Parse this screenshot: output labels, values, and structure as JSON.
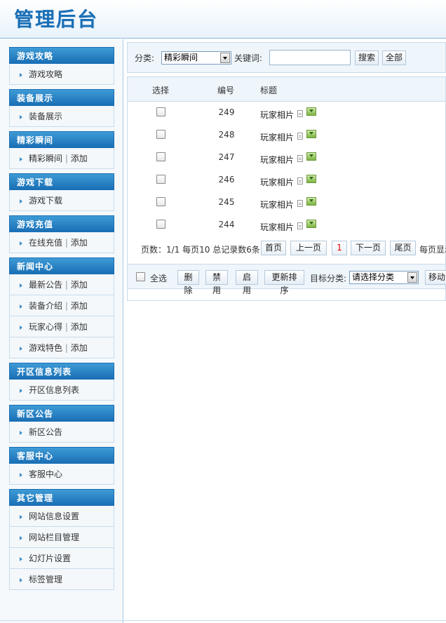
{
  "header": {
    "title": "管理后台"
  },
  "sidebar": {
    "sections": [
      {
        "title": "游戏攻略",
        "items": [
          {
            "label": "游戏攻略"
          }
        ]
      },
      {
        "title": "装备展示",
        "items": [
          {
            "label": "装备展示"
          }
        ]
      },
      {
        "title": "精彩瞬间",
        "items": [
          {
            "label": "精彩瞬间",
            "add": "添加"
          }
        ]
      },
      {
        "title": "游戏下载",
        "items": [
          {
            "label": "游戏下载"
          }
        ]
      },
      {
        "title": "游戏充值",
        "items": [
          {
            "label": "在线充值",
            "add": "添加"
          }
        ]
      },
      {
        "title": "新闻中心",
        "items": [
          {
            "label": "最新公告",
            "add": "添加"
          },
          {
            "label": "装备介绍",
            "add": "添加"
          },
          {
            "label": "玩家心得",
            "add": "添加"
          },
          {
            "label": "游戏特色",
            "add": "添加"
          }
        ]
      },
      {
        "title": "开区信息列表",
        "items": [
          {
            "label": "开区信息列表"
          }
        ]
      },
      {
        "title": "新区公告",
        "items": [
          {
            "label": "新区公告"
          }
        ]
      },
      {
        "title": "客服中心",
        "items": [
          {
            "label": "客服中心"
          }
        ]
      },
      {
        "title": "其它管理",
        "items": [
          {
            "label": "网站信息设置"
          },
          {
            "label": "网站栏目管理"
          },
          {
            "label": "幻灯片设置"
          },
          {
            "label": "标签管理"
          }
        ]
      }
    ]
  },
  "toolbar": {
    "category_label": "分类:",
    "category_value": "精彩瞬间",
    "keyword_label": "关键词:",
    "keyword_value": "",
    "search_button": "搜索",
    "all_button": "全部"
  },
  "table": {
    "headers": {
      "select": "选择",
      "id": "编号",
      "title": "标题"
    },
    "rows": [
      {
        "id": "249",
        "title": "玩家相片"
      },
      {
        "id": "248",
        "title": "玩家相片"
      },
      {
        "id": "247",
        "title": "玩家相片"
      },
      {
        "id": "246",
        "title": "玩家相片"
      },
      {
        "id": "245",
        "title": "玩家相片"
      },
      {
        "id": "244",
        "title": "玩家相片"
      }
    ]
  },
  "pager": {
    "info": "页数：1/1 每页10 总记录数6条",
    "first": "首页",
    "prev": "上一页",
    "current": "1",
    "next": "下一页",
    "last": "尾页",
    "per_page_label": "每页显示"
  },
  "actions": {
    "select_all": "全选",
    "delete": "删除",
    "disable": "禁用",
    "enable": "启用",
    "update_sort": "更新排序",
    "target_category_label": "目标分类:",
    "target_category_value": "请选择分类",
    "move": "移动"
  }
}
